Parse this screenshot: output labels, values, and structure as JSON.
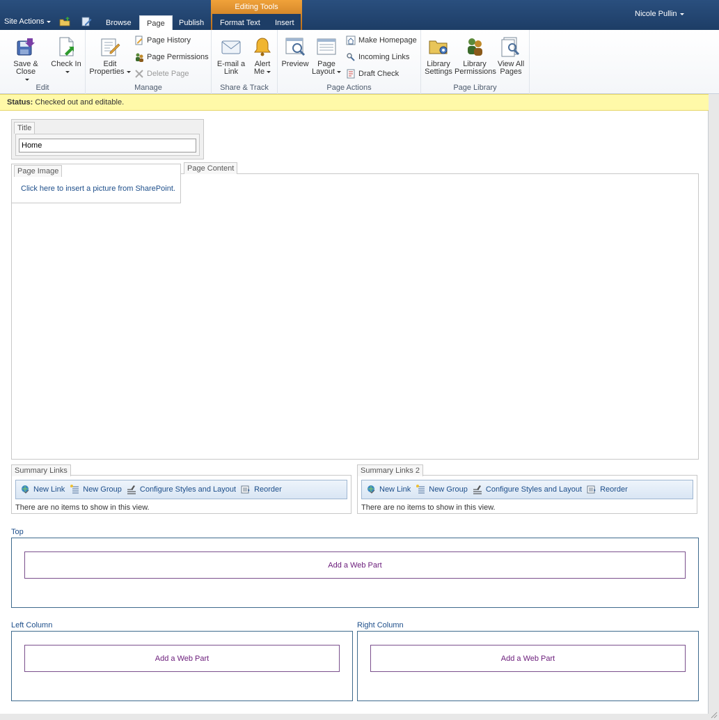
{
  "topbar": {
    "site_actions": "Site Actions",
    "tabs": {
      "browse": "Browse",
      "page": "Page",
      "publish": "Publish",
      "format_text": "Format Text",
      "insert": "Insert"
    },
    "editing_tools": "Editing Tools",
    "user": "Nicole Pullin"
  },
  "ribbon": {
    "edit": {
      "label": "Edit",
      "save_close": "Save & Close",
      "check_in": "Check In"
    },
    "manage": {
      "label": "Manage",
      "edit_properties_line1": "Edit",
      "edit_properties_line2": "Properties",
      "page_history": "Page History",
      "page_permissions": "Page Permissions",
      "delete_page": "Delete Page"
    },
    "share": {
      "label": "Share & Track",
      "email_line1": "E-mail a",
      "email_line2": "Link",
      "alert_line1": "Alert",
      "alert_line2": "Me"
    },
    "page_actions": {
      "label": "Page Actions",
      "preview": "Preview",
      "layout_line1": "Page",
      "layout_line2": "Layout",
      "make_homepage": "Make Homepage",
      "incoming_links": "Incoming Links",
      "draft_check": "Draft Check"
    },
    "library": {
      "label": "Page Library",
      "settings_line1": "Library",
      "settings_line2": "Settings",
      "permissions_line1": "Library",
      "permissions_line2": "Permissions",
      "view_all_line1": "View All",
      "view_all_line2": "Pages"
    }
  },
  "status": {
    "label": "Status:",
    "text": "Checked out and editable."
  },
  "title_field": {
    "label": "Title",
    "value": "Home"
  },
  "page_image": {
    "label": "Page Image",
    "link": "Click here to insert a picture from SharePoint."
  },
  "page_content": {
    "label": "Page Content"
  },
  "summary_links": [
    {
      "label": "Summary Links",
      "new_link": "New Link",
      "new_group": "New Group",
      "configure": "Configure Styles and Layout",
      "reorder": "Reorder",
      "empty": "There are no items to show in this view."
    },
    {
      "label": "Summary Links 2",
      "new_link": "New Link",
      "new_group": "New Group",
      "configure": "Configure Styles and Layout",
      "reorder": "Reorder",
      "empty": "There are no items to show in this view."
    }
  ],
  "zones": {
    "top": {
      "label": "Top",
      "add": "Add a Web Part"
    },
    "left": {
      "label": "Left Column",
      "add": "Add a Web Part"
    },
    "right": {
      "label": "Right Column",
      "add": "Add a Web Part"
    }
  },
  "colors": {
    "topbar": "#1d3d66",
    "contextual": "#f0a23a",
    "status_bg": "#fff9a8",
    "link": "#1d4e8a",
    "webpart": "#6a1b7a"
  }
}
